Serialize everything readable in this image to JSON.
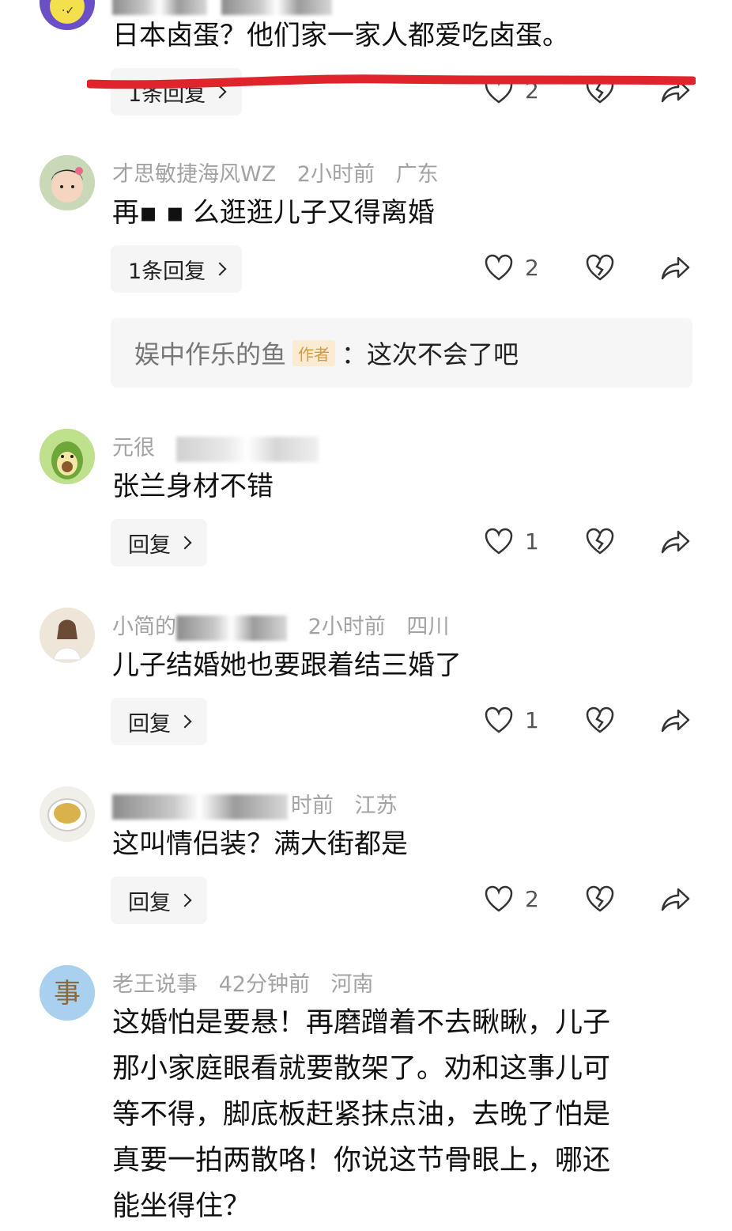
{
  "comments": [
    {
      "text": "日本卤蛋？他们家一家人都爱吃卤蛋。",
      "reply_label": "1条回复",
      "like_count": "2"
    },
    {
      "username": "才思敏捷海风WZ",
      "time": "2小时前",
      "location": "广东",
      "text": "再▪ ▪ 么逛逛儿子又得离婚",
      "reply_label": "1条回复",
      "like_count": "2",
      "author_reply": {
        "name": "娱中作乐的鱼",
        "tag": "作者",
        "text": "：这次不会了吧"
      }
    },
    {
      "username": "元很",
      "text": "张兰身材不错",
      "reply_label": "回复",
      "like_count": "1"
    },
    {
      "username": "小简的",
      "time": "2小时前",
      "location": "四川",
      "text": "儿子结婚她也要跟着结三婚了",
      "reply_label": "回复",
      "like_count": "1"
    },
    {
      "time": "时前",
      "location": "江苏",
      "text": "这叫情侣装？满大街都是",
      "reply_label": "回复",
      "like_count": "2"
    },
    {
      "username": "老王说事",
      "time": "42分钟前",
      "location": "河南",
      "avatar_char": "事",
      "text_lines": [
        "这婚怕是要悬！再磨蹭着不去瞅瞅，儿子",
        "那小家庭眼看就要散架了。劝和这事儿可",
        "等不得，脚底板赶紧抹点油，去晚了怕是",
        "真要一拍两散咯！你说这节骨眼上，哪还",
        "能坐得住？"
      ]
    }
  ],
  "icons": {
    "like": "heart-outline-icon",
    "dislike": "broken-heart-icon",
    "share": "share-arrow-icon",
    "chevron": "chevron-right-icon"
  },
  "colors": {
    "annotation_line": "#e0242c",
    "meta_text": "#a3a3a3",
    "author_tag_bg": "#fbebd2",
    "author_tag_text": "#d39a3e"
  }
}
